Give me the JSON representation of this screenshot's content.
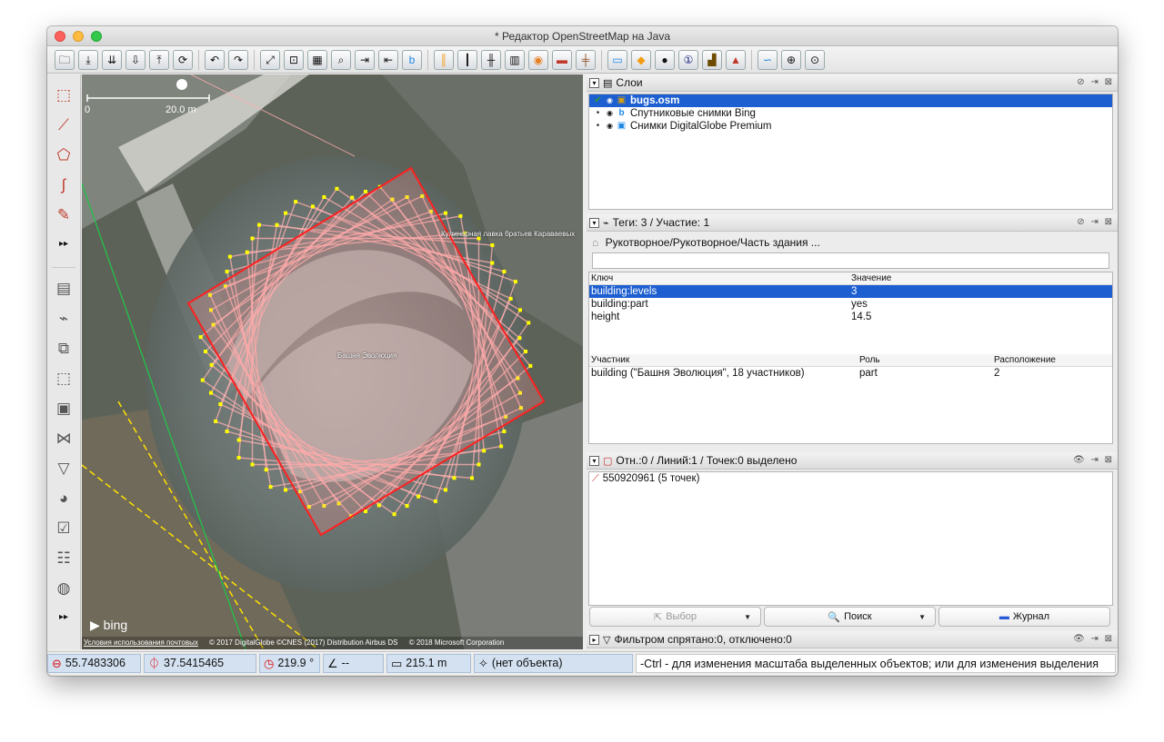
{
  "window": {
    "title": "* Редактор OpenStreetMap на Java"
  },
  "toolbar": {
    "icons": [
      "open-file-icon",
      "download-icon",
      "download-along-icon",
      "download-selection-icon",
      "upload-icon",
      "update-data-icon",
      "undo-icon",
      "redo-icon",
      "zoom-to-data-icon",
      "zoom-to-selection-icon",
      "wms-icon",
      "search-icon",
      "split-way-icon",
      "combine-way-icon",
      "bing-icon",
      "highway-icon",
      "road-icon",
      "railway-icon",
      "tracks-icon",
      "traffic-light-icon",
      "wall-icon",
      "rail-icon",
      "bed-icon",
      "bag-icon",
      "ball-icon",
      "number-icon",
      "factory-icon",
      "mountain-icon",
      "curve-icon",
      "zoom-in-icon",
      "zoom-icon"
    ]
  },
  "lefttools": {
    "icons": [
      "select-icon",
      "draw-line-icon",
      "draw-polygon-icon",
      "curve-tool-icon",
      "pencil-icon",
      "expand-icon",
      "layers-icon",
      "tag-icon",
      "relation-icon",
      "selection-icon",
      "image-icon",
      "join-icon",
      "filter-icon",
      "palette-icon",
      "validator-icon",
      "checklist-icon",
      "globe-icon",
      "expand-more-icon"
    ]
  },
  "map": {
    "scale_label": "20.0 m",
    "scale_zero": "0",
    "labels": {
      "tower": "Башня Эволюция",
      "shop": "Кулинарная лавка братьев Караваевых"
    },
    "bing_text": "bing",
    "attribution": {
      "terms": "Условия использования почтовых",
      "copyright1": "© 2017 DigitalGlobe ©CNES (2017) Distribution Airbus DS",
      "copyright2": "© 2018 Microsoft Corporation"
    },
    "colors": {
      "selection": "#ff2020",
      "outline": "#ffb0b0",
      "nodes": "#ffff00"
    }
  },
  "layers_panel": {
    "title": "Слои",
    "layers": [
      {
        "name": "bugs.osm",
        "selected": true
      },
      {
        "name": "Спутниковые снимки Bing",
        "selected": false
      },
      {
        "name": "Снимки DigitalGlobe Premium",
        "selected": false
      }
    ]
  },
  "tags_panel": {
    "title": "Теги: 3 / Участие: 1",
    "preset": "Рукотворное/Рукотворное/Часть здания ...",
    "columns": {
      "key": "Ключ",
      "value": "Значение"
    },
    "rows": [
      {
        "key": "building:levels",
        "value": "3",
        "selected": true
      },
      {
        "key": "building:part",
        "value": "yes",
        "selected": false
      },
      {
        "key": "height",
        "value": "14.5",
        "selected": false
      }
    ],
    "membership_columns": {
      "member": "Участник",
      "role": "Роль",
      "position": "Расположение"
    },
    "membership": [
      {
        "member": "building (\"Башня Эволюция\", 18 участников)",
        "role": "part",
        "position": "2"
      }
    ]
  },
  "selection_panel": {
    "title": "Отн.:0 / Линий:1 / Точек:0 выделено",
    "items": [
      {
        "label": "550920961 (5 точек)"
      }
    ],
    "buttons": {
      "select": "Выбор",
      "search": "Поиск",
      "history": "Журнал"
    }
  },
  "filter_panel": {
    "title": "Фильтром спрятано:0, отключено:0"
  },
  "statusbar": {
    "lat": "55.7483306",
    "lon": "37.5415465",
    "heading": "219.9 °",
    "angle": "--",
    "distance": "215.1 m",
    "object": "(нет объекта)",
    "help": "-Ctrl - для изменения масштаба выделенных объектов; или для изменения выделения"
  }
}
